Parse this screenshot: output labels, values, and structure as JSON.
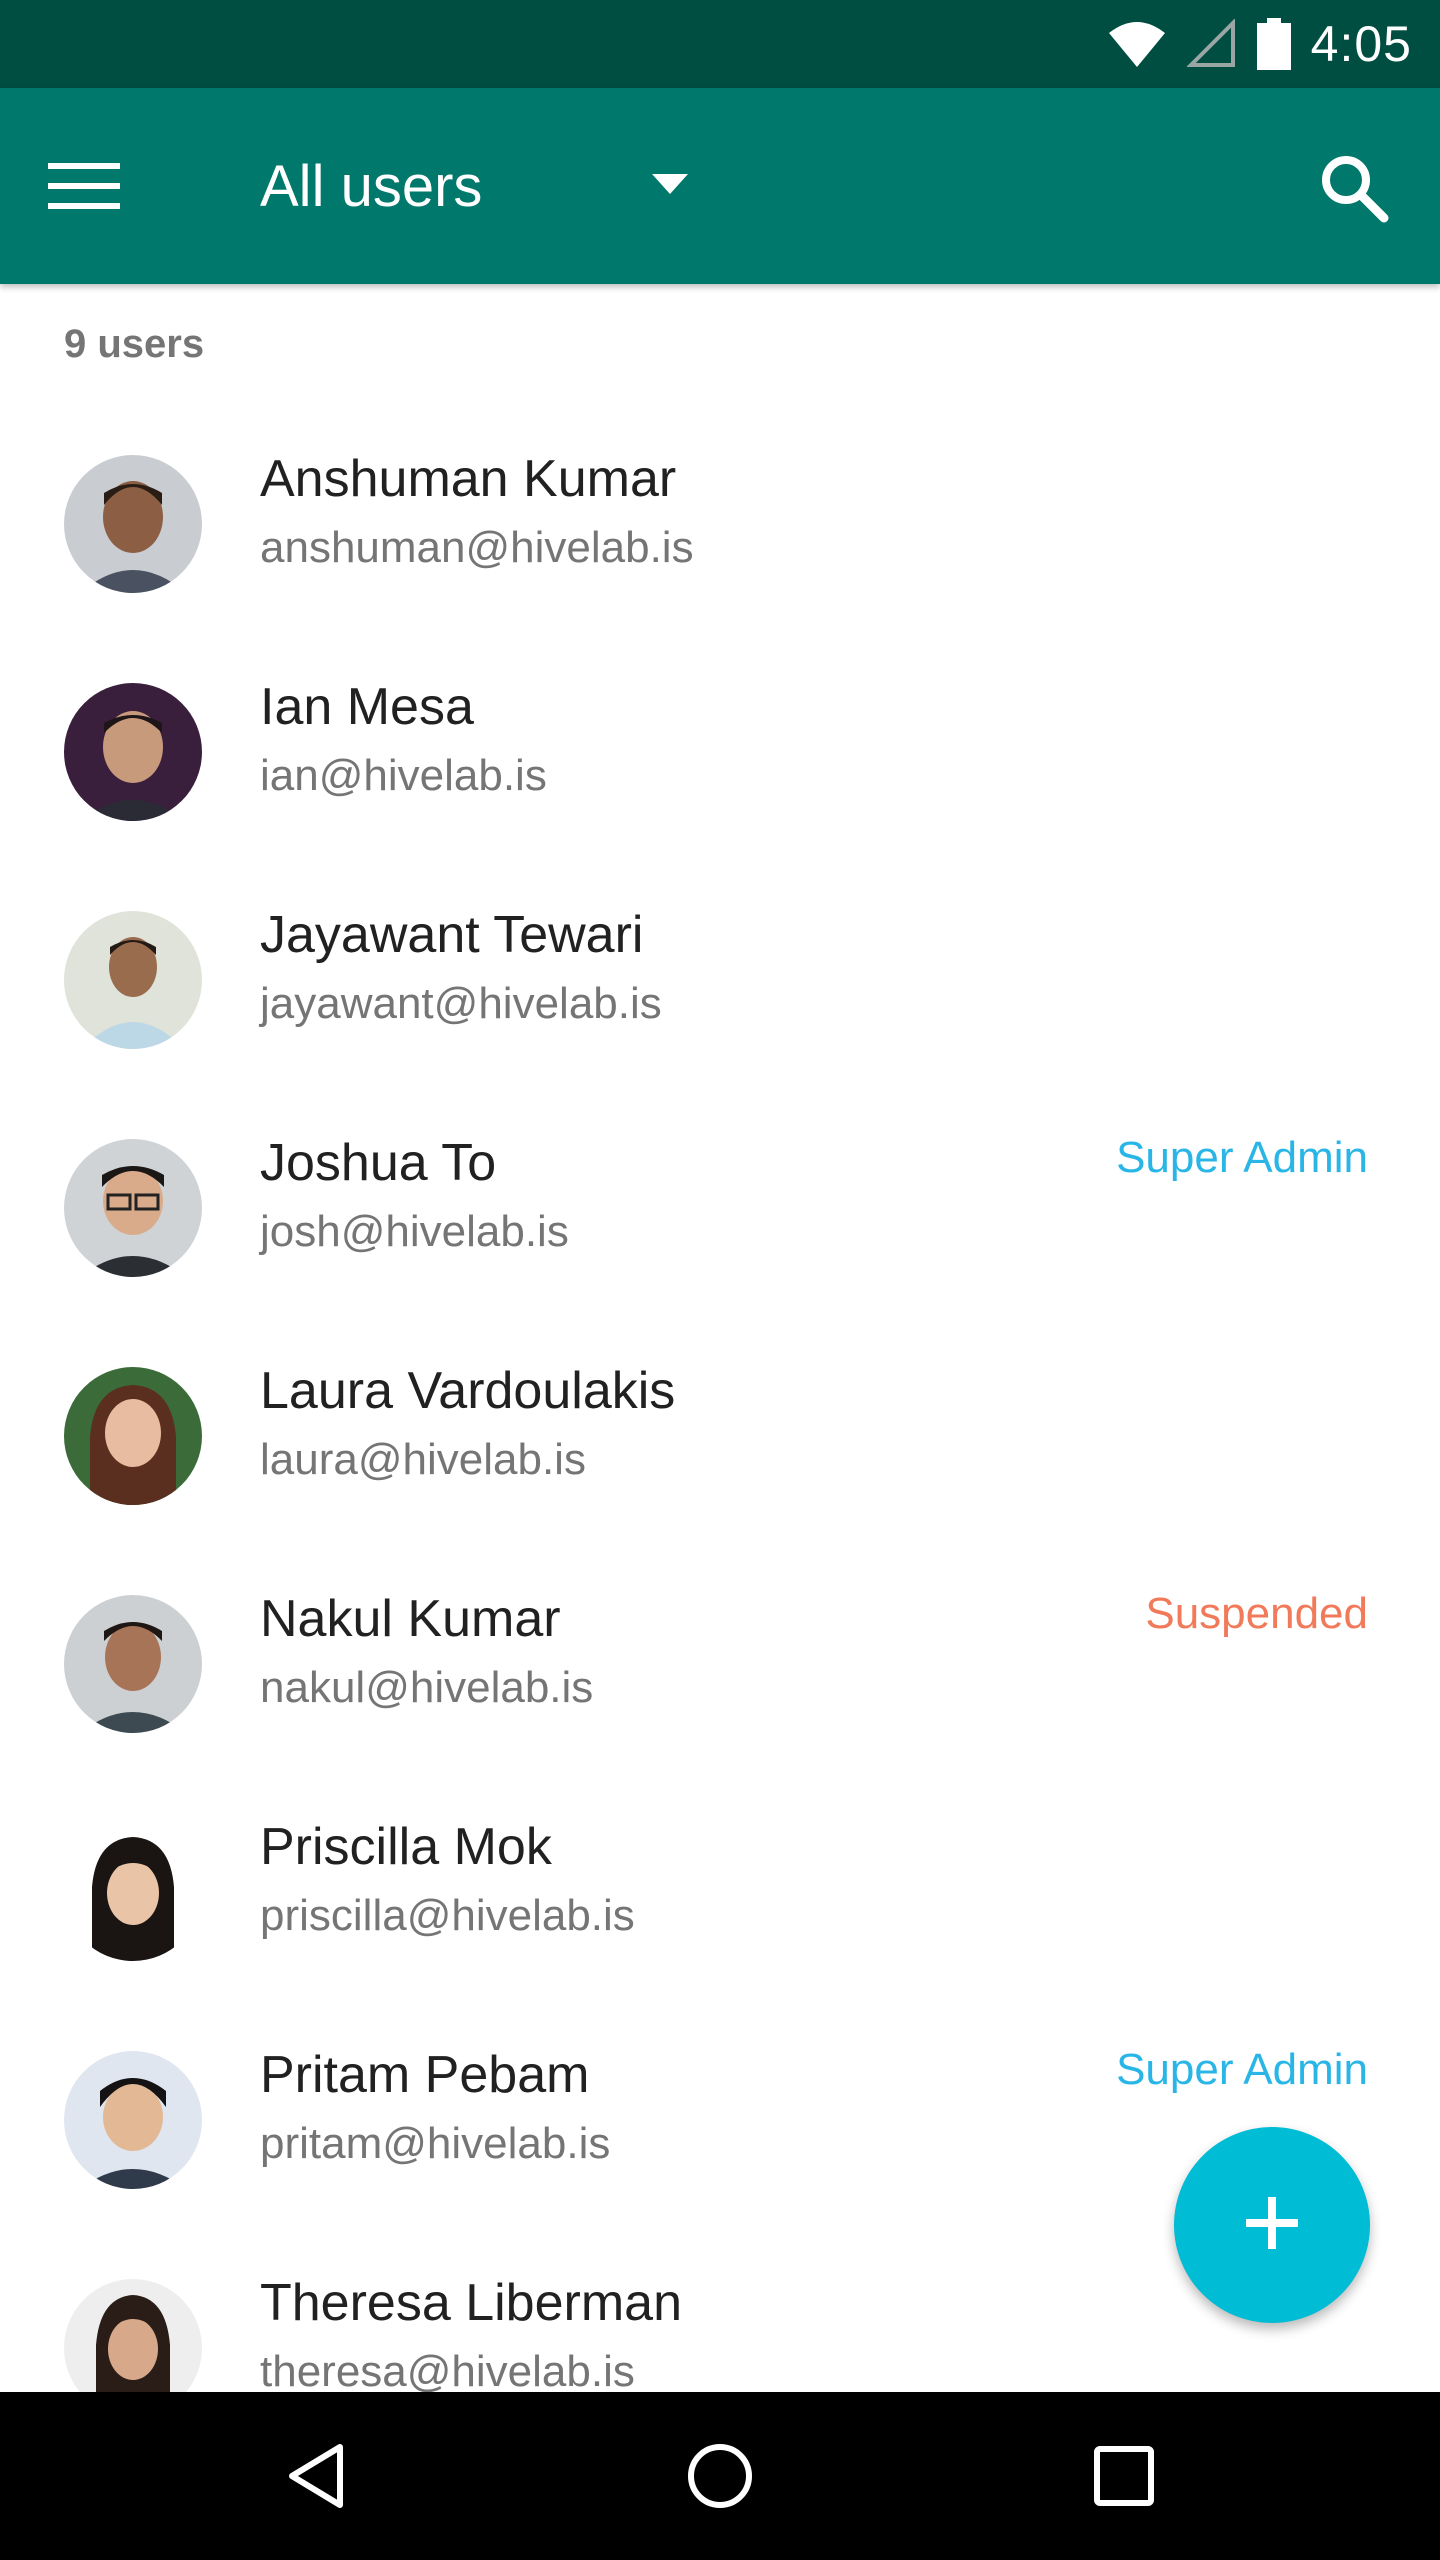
{
  "status_bar": {
    "time": "4:05",
    "icons": [
      "wifi-icon",
      "cell-signal-icon",
      "battery-icon"
    ]
  },
  "app_bar": {
    "title": "All users",
    "menu_icon": "hamburger-menu-icon",
    "dropdown_icon": "dropdown-arrow-icon",
    "search_icon": "search-icon",
    "color": "#00786b"
  },
  "list": {
    "count_label": "9 users",
    "users": [
      {
        "name": "Anshuman Kumar",
        "email": "anshuman@hivelab.is",
        "role": ""
      },
      {
        "name": "Ian Mesa",
        "email": "ian@hivelab.is",
        "role": ""
      },
      {
        "name": "Jayawant Tewari",
        "email": "jayawant@hivelab.is",
        "role": ""
      },
      {
        "name": "Joshua To",
        "email": "josh@hivelab.is",
        "role": "Super Admin"
      },
      {
        "name": "Laura Vardoulakis",
        "email": "laura@hivelab.is",
        "role": ""
      },
      {
        "name": "Nakul Kumar",
        "email": "nakul@hivelab.is",
        "role": "Suspended"
      },
      {
        "name": "Priscilla Mok",
        "email": "priscilla@hivelab.is",
        "role": ""
      },
      {
        "name": "Pritam Pebam",
        "email": "pritam@hivelab.is",
        "role": "Super Admin"
      },
      {
        "name": "Theresa Liberman",
        "email": "theresa@hivelab.is",
        "role": ""
      }
    ]
  },
  "fab": {
    "icon": "plus-icon",
    "color": "#00bcd4"
  },
  "nav_bar": {
    "icons": [
      "back-triangle-icon",
      "home-circle-icon",
      "recents-square-icon"
    ]
  },
  "colors": {
    "super_admin": "#29b6e6",
    "suspended": "#f07a5a"
  }
}
